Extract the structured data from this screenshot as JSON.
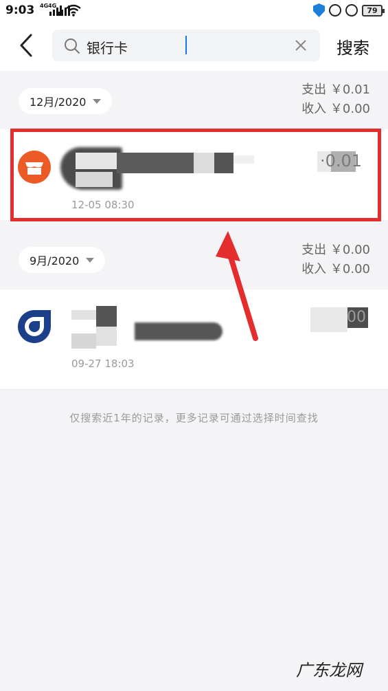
{
  "status_bar": {
    "time": "9:03",
    "signal_tags": [
      "4G",
      "4G"
    ],
    "battery": "79",
    "icons": [
      "signal-icon",
      "wifi-icon",
      "shield-icon",
      "lock-icon",
      "alarm-icon",
      "battery-icon"
    ]
  },
  "header": {
    "query": "银行卡",
    "search_button": "搜索"
  },
  "groups": [
    {
      "month": "12月/2020",
      "expense": "支出 ￥0.01",
      "income": "收入 ￥0.00",
      "transactions": [
        {
          "time": "12-05  08:30",
          "amount_visible": "·0.01",
          "icon": "store-icon",
          "icon_color": "#ec5a25"
        }
      ]
    },
    {
      "month": "9月/2020",
      "expense": "支出 ￥0.00",
      "income": "收入 ￥0.00",
      "transactions": [
        {
          "time": "09-27  18:03",
          "amount_visible": "00",
          "icon": "ccb-bank-icon",
          "icon_color": "#1d3f8a"
        }
      ]
    }
  ],
  "footer_note": "仅搜索近1年的记录，更多记录可通过选择时间查找",
  "watermark": "广东龙网",
  "annotation": {
    "box_color": "#e42d2d",
    "arrow_color": "#e42d2d"
  }
}
